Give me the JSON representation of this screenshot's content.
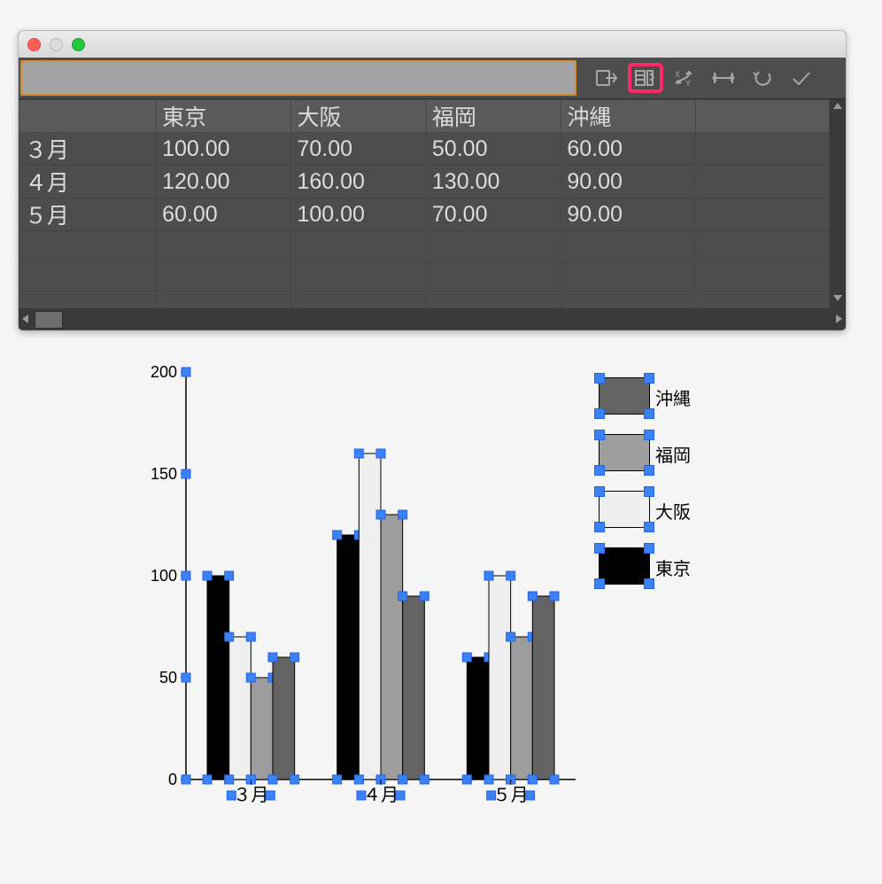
{
  "table": {
    "columns": [
      "東京",
      "大阪",
      "福岡",
      "沖縄"
    ],
    "rows": [
      {
        "label": "３月",
        "cells": [
          "100.00",
          "70.00",
          "50.00",
          "60.00"
        ]
      },
      {
        "label": "４月",
        "cells": [
          "120.00",
          "160.00",
          "130.00",
          "90.00"
        ]
      },
      {
        "label": "５月",
        "cells": [
          "60.00",
          "100.00",
          "70.00",
          "90.00"
        ]
      }
    ]
  },
  "toolbar_icons": [
    "import-data-icon",
    "table-edit-icon",
    "swap-xy-icon",
    "frame-icon",
    "undo-icon",
    "confirm-icon"
  ],
  "chart_data": {
    "type": "bar",
    "categories": [
      "３月",
      "４月",
      "５月"
    ],
    "series": [
      {
        "name": "東京",
        "values": [
          100,
          120,
          60
        ],
        "color": "#000000"
      },
      {
        "name": "大阪",
        "values": [
          70,
          160,
          100
        ],
        "color": "#efefef"
      },
      {
        "name": "福岡",
        "values": [
          50,
          130,
          70
        ],
        "color": "#9d9d9d"
      },
      {
        "name": "沖縄",
        "values": [
          60,
          90,
          90
        ],
        "color": "#636363"
      }
    ],
    "legend_order": [
      "沖縄",
      "福岡",
      "大阪",
      "東京"
    ],
    "ylim": [
      0,
      200
    ],
    "yticks": [
      0,
      50,
      100,
      150,
      200
    ],
    "xlabel": "",
    "ylabel": "",
    "title": ""
  }
}
